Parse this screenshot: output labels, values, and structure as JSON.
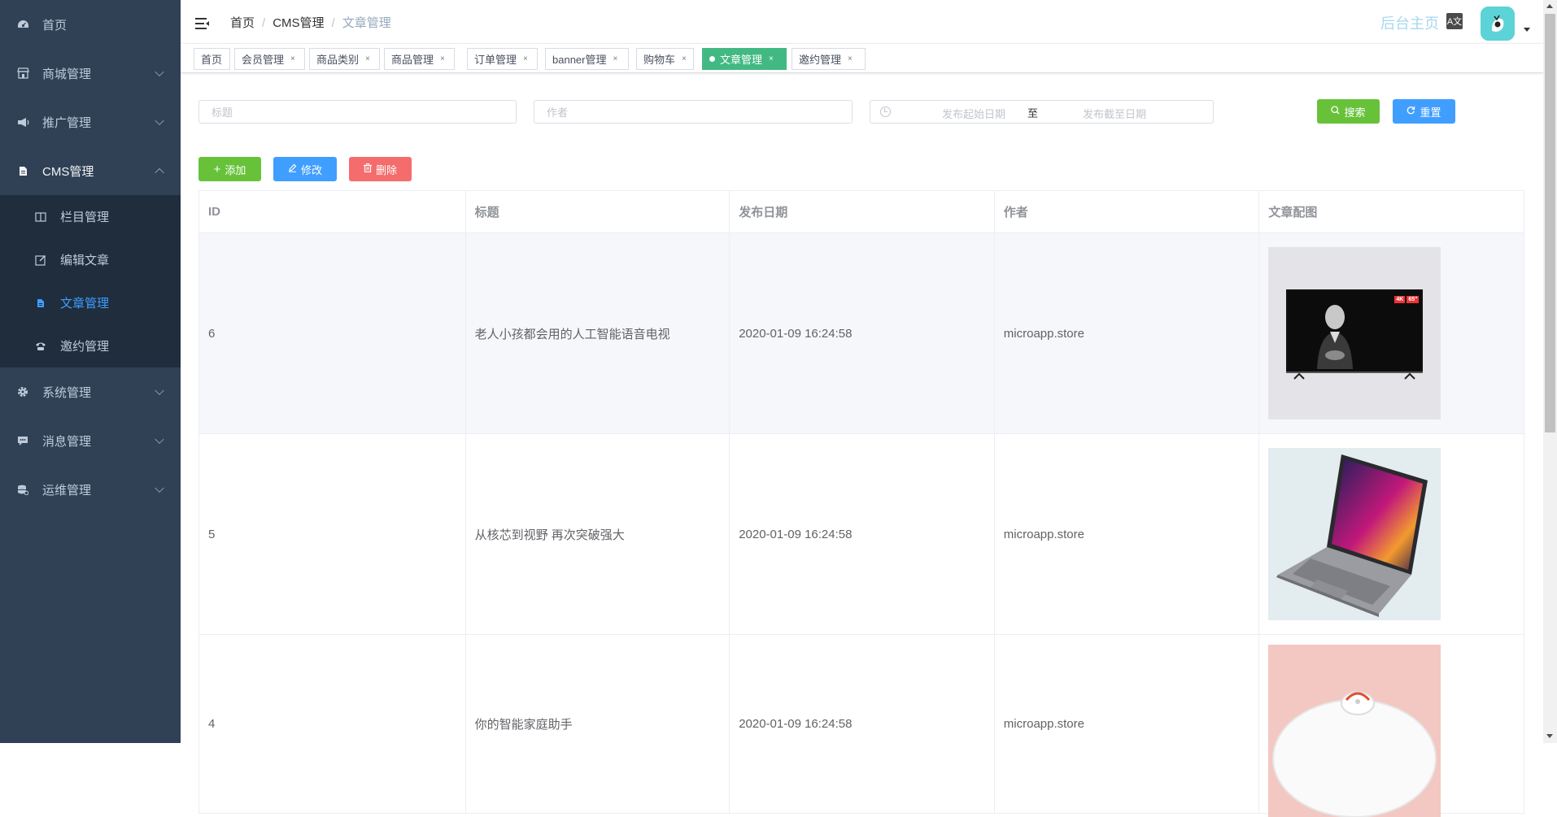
{
  "sidebar": {
    "items": [
      {
        "label": "首页",
        "icon": "dashboard-icon"
      },
      {
        "label": "商城管理",
        "icon": "shop-icon"
      },
      {
        "label": "推广管理",
        "icon": "megaphone-icon"
      },
      {
        "label": "CMS管理",
        "icon": "document-icon",
        "expanded": true
      },
      {
        "label": "系统管理",
        "icon": "gear-icon"
      },
      {
        "label": "消息管理",
        "icon": "chat-icon"
      },
      {
        "label": "运维管理",
        "icon": "server-icon"
      }
    ],
    "cms_children": [
      {
        "label": "栏目管理",
        "icon": "book-icon"
      },
      {
        "label": "编辑文章",
        "icon": "edit-icon"
      },
      {
        "label": "文章管理",
        "icon": "document-icon",
        "active": true
      },
      {
        "label": "邀约管理",
        "icon": "phone-icon"
      }
    ]
  },
  "header": {
    "breadcrumb": [
      "首页",
      "CMS管理",
      "文章管理"
    ],
    "home_link": "后台主页",
    "lang_icon_text": "A文"
  },
  "tags": [
    {
      "label": "首页",
      "closable": false
    },
    {
      "label": "会员管理",
      "closable": true
    },
    {
      "label": "商品类别",
      "closable": true
    },
    {
      "label": "商品管理",
      "closable": true
    },
    {
      "label": "订单管理",
      "closable": true
    },
    {
      "label": "banner管理",
      "closable": true
    },
    {
      "label": "购物车",
      "closable": true
    },
    {
      "label": "文章管理",
      "closable": true,
      "active": true
    },
    {
      "label": "邀约管理",
      "closable": true
    }
  ],
  "tag_close": "×",
  "filters": {
    "title_placeholder": "标题",
    "author_placeholder": "作者",
    "date_start_placeholder": "发布起始日期",
    "date_sep": "至",
    "date_end_placeholder": "发布截至日期",
    "search_label": "搜索",
    "reset_label": "重置"
  },
  "actions": {
    "add_label": "添加",
    "edit_label": "修改",
    "delete_label": "删除"
  },
  "table": {
    "columns": [
      "ID",
      "标题",
      "发布日期",
      "作者",
      "文章配图"
    ],
    "rows": [
      {
        "id": "6",
        "title": "老人小孩都会用的人工智能语音电视",
        "date": "2020-01-09 16:24:58",
        "author": "microapp.store",
        "image": "tv"
      },
      {
        "id": "5",
        "title": "从核芯到视野 再次突破强大",
        "date": "2020-01-09 16:24:58",
        "author": "microapp.store",
        "image": "laptop"
      },
      {
        "id": "4",
        "title": "你的智能家庭助手",
        "date": "2020-01-09 16:24:58",
        "author": "microapp.store",
        "image": "robot-vacuum"
      }
    ]
  },
  "tv_badges": [
    "4K",
    "65\""
  ],
  "colors": {
    "sidebar_bg": "#304156",
    "submenu_bg": "#1f2d3d",
    "active_menu": "#409eff",
    "active_tag": "#42b983"
  }
}
